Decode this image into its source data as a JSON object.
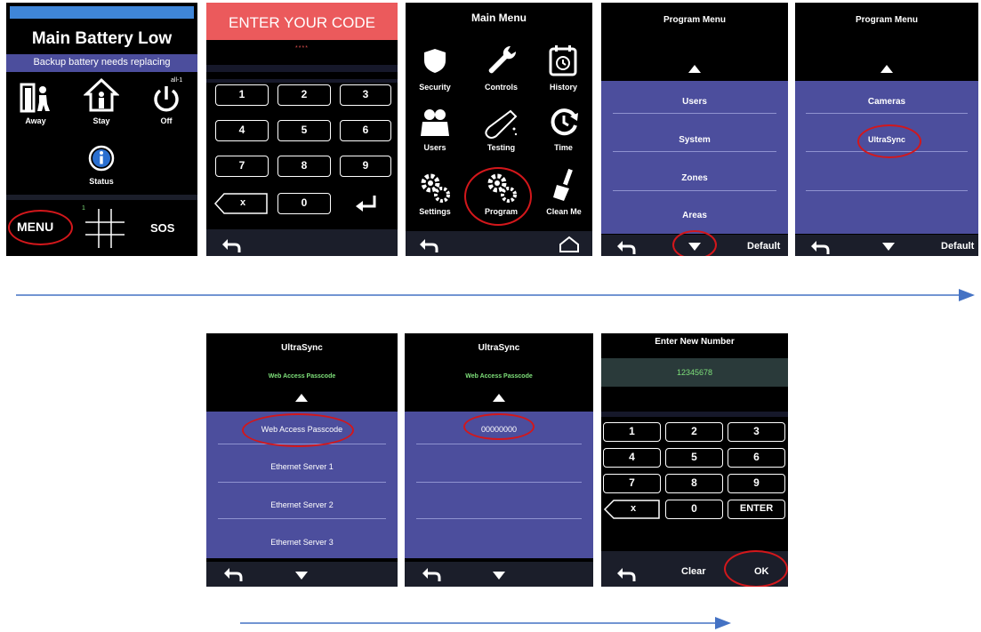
{
  "screen1": {
    "title": "Main Battery Low",
    "subtitle": "Backup battery needs replacing",
    "away": "Away",
    "stay": "Stay",
    "off": "Off",
    "off_badge": "all-1",
    "status": "Status",
    "menu": "MENU",
    "grid_badge": "1",
    "sos": "SOS"
  },
  "screen2": {
    "header": "ENTER YOUR CODE",
    "code_mask": "****",
    "keys": [
      "1",
      "2",
      "3",
      "4",
      "5",
      "6",
      "7",
      "8",
      "9",
      "x",
      "0"
    ]
  },
  "screen3": {
    "title": "Main Menu",
    "items": [
      "Security",
      "Controls",
      "History",
      "Users",
      "Testing",
      "Time",
      "Settings",
      "Program",
      "Clean Me"
    ]
  },
  "screen4": {
    "title": "Program Menu",
    "items": [
      "Users",
      "System",
      "Zones",
      "Areas"
    ],
    "default": "Default"
  },
  "screen5": {
    "title": "Program Menu",
    "items": [
      "Cameras",
      "UltraSync"
    ],
    "default": "Default"
  },
  "screen6": {
    "title": "UltraSync",
    "subtitle": "Web Access Passcode",
    "items": [
      "Web Access Passcode",
      "Ethernet Server 1",
      "Ethernet Server 2",
      "Ethernet Server 3"
    ]
  },
  "screen7": {
    "title": "UltraSync",
    "subtitle": "Web Access Passcode",
    "value": "00000000"
  },
  "screen8": {
    "title": "Enter New Number",
    "value": "12345678",
    "keys": [
      "1",
      "2",
      "3",
      "4",
      "5",
      "6",
      "7",
      "8",
      "9",
      "x",
      "0",
      "ENTER"
    ],
    "clear": "Clear",
    "ok": "OK"
  },
  "colors": {
    "highlight": "#d3171b",
    "arrow": "#4472c4",
    "panel": "#4c4e9d",
    "code_green": "#7ee07a"
  }
}
